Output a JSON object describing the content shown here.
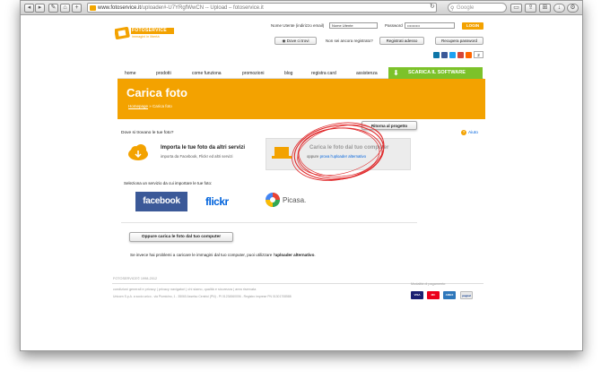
{
  "browser": {
    "url_domain": "www.fotoservice.it",
    "url_rest": "/uploader#-U7YRgfWwCN -- Upload – fotoservice.it",
    "search_placeholder": "Google"
  },
  "header": {
    "logo_text": "FOTOSERVICE",
    "logo_tagline": "immagini in libertà",
    "username_label": "Nome Utente (indirizzo email)",
    "username_value": "Nome Utente",
    "password_label": "Password",
    "password_value": "••••••••••",
    "login_button": "LOGIN",
    "not_registered": "Non sei ancora registrato?",
    "where_button": "Dove ci trovi",
    "register_button": "Registrati adesso",
    "recover_button": "Recupera password",
    "social_count": "2"
  },
  "nav": {
    "items": [
      "home",
      "prodotti",
      "come funziona",
      "promozioni",
      "blog",
      "registra card",
      "assistenza"
    ],
    "software_button": "SCARICA IL SOFTWARE"
  },
  "banner": {
    "title": "Carica foto",
    "crumb_home": "Homepage",
    "crumb_current": "» Carica foto"
  },
  "content": {
    "back_button": "Ritorna al progetto",
    "question": "Dove si trovano le tue foto?",
    "help": "Aiuto",
    "option_a_title": "Importa le tue foto da altri servizi",
    "option_a_sub": "importa da Facebook, Flickr ed altri servizi",
    "option_b_title": "Carica le foto dal tuo computer",
    "option_b_sub_pre": "oppure",
    "option_b_sub_link": "prova l'uploader alternativo",
    "select_service": "Seleziona un servizio da cui importare le tue foto:",
    "services": [
      "facebook",
      "flickr",
      "Picasa."
    ],
    "or_upload_button": "Oppure carica le foto dal tuo computer",
    "problem_text_pre": "Se invece hai problemi a caricare le immagini dal tuo computer, puoi utilizzare l'",
    "problem_text_link": "uploader alternativo",
    "problem_text_post": "."
  },
  "footer": {
    "copyright": "FOTOSERVICE© 1998-2012",
    "links": "condizioni generali e privacy  |  privacy navigatori  |  chi siamo, qualità e sicurezza  |  area riservata",
    "address": "Unicorn S.p.A. a socio unico - via Piumicino, 1 - 35060 Asseiso Centrici (PN) - PI 01234560006 - Registro imprese PN 01301708588",
    "payment_label": "Modalità di pagamento",
    "cards": [
      "VISA",
      "MC",
      "AMEX",
      "paypal"
    ]
  },
  "colors": {
    "orange": "#f3a200",
    "green": "#7cc22a",
    "facebook": "#3b5998",
    "flickr_blue": "#0063dc",
    "flickr_pink": "#ff0084",
    "red_circle": "#e0282a"
  }
}
